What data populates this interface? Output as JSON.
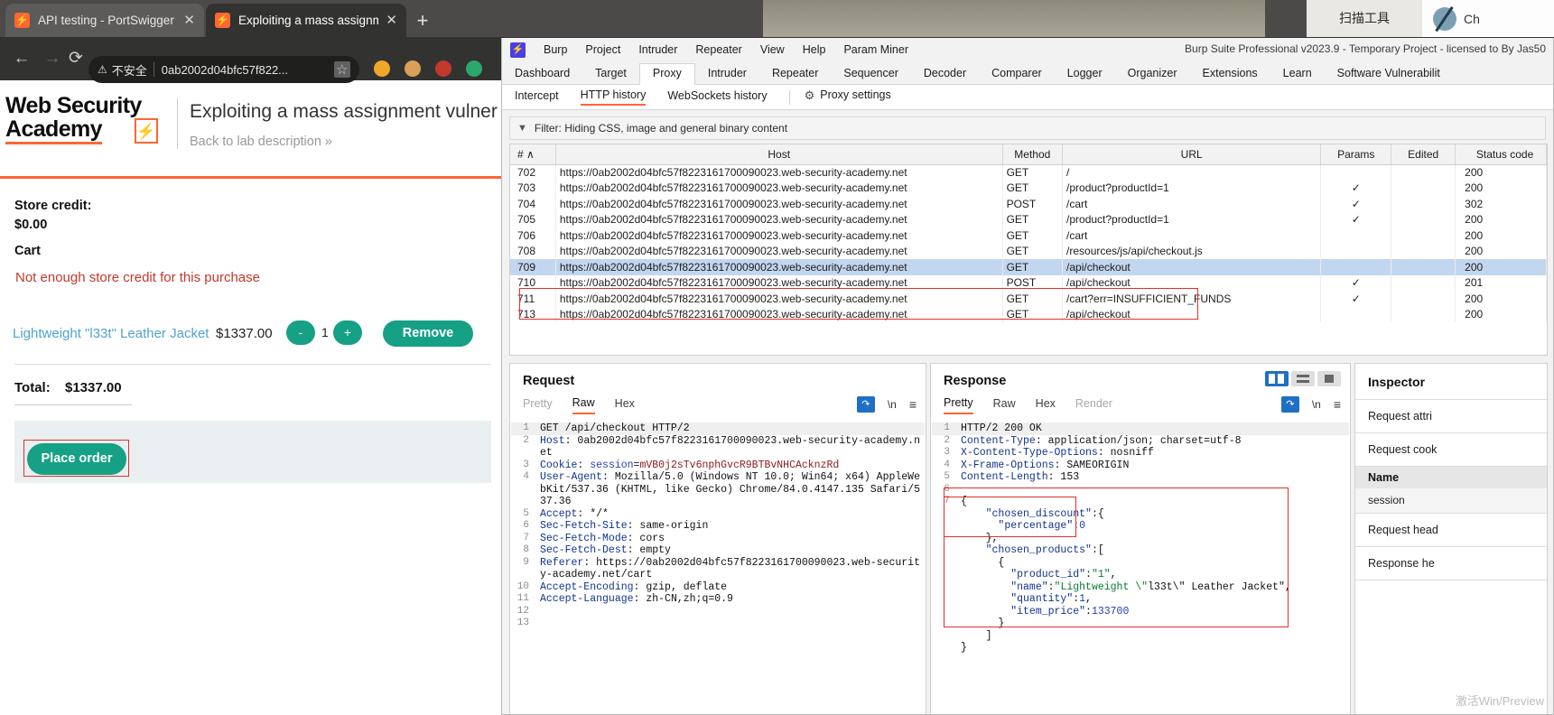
{
  "browser": {
    "tabs": [
      {
        "title": "API testing - PortSwigger",
        "active": false
      },
      {
        "title": "Exploiting a mass assignment v",
        "active": true
      }
    ],
    "new_tab_label": "+",
    "window_buttons": [
      "—",
      "❐",
      "✕"
    ],
    "nav": {
      "back": "←",
      "forward": "→",
      "reload": "⟳"
    },
    "omnibox": {
      "warning_icon": "⚠",
      "security_label": "不安全",
      "url": "0ab2002d04bfc57f822...",
      "translate_icon": "translate-icon",
      "star_icon": "☆"
    },
    "scan_tool_label": "扫描工具",
    "chrome_pill_label": "Ch"
  },
  "lab": {
    "logo_line1": "Web Security",
    "logo_line2": "Academy",
    "logo_bolt": "⚡",
    "title": "Exploiting a mass assignment vulner",
    "back_link": "Back to lab description  »",
    "store_credit_label": "Store credit:",
    "store_credit_value": "$0.00",
    "cart_label": "Cart",
    "cart_warning": "Not enough store credit for this purchase",
    "cart_item": {
      "name": "Lightweight \"l33t\" Leather Jacket",
      "price": "$1337.00",
      "minus": "-",
      "quantity": "1",
      "plus": "+",
      "remove": "Remove"
    },
    "total_label": "Total:",
    "total_value": "$1337.00",
    "place_order": "Place order"
  },
  "burp": {
    "window_title": "Burp Suite Professional v2023.9 - Temporary Project - licensed to By Jas50",
    "menu": [
      "Burp",
      "Project",
      "Intruder",
      "Repeater",
      "View",
      "Help",
      "Param Miner"
    ],
    "tabs": [
      {
        "label": "Dashboard",
        "active": false
      },
      {
        "label": "Target",
        "active": false
      },
      {
        "label": "Proxy",
        "active": true
      },
      {
        "label": "Intruder",
        "active": false
      },
      {
        "label": "Repeater",
        "active": false
      },
      {
        "label": "Sequencer",
        "active": false
      },
      {
        "label": "Decoder",
        "active": false
      },
      {
        "label": "Comparer",
        "active": false
      },
      {
        "label": "Logger",
        "active": false
      },
      {
        "label": "Organizer",
        "active": false
      },
      {
        "label": "Extensions",
        "active": false
      },
      {
        "label": "Learn",
        "active": false
      },
      {
        "label": "Software Vulnerabilit",
        "active": false
      }
    ],
    "subtabs": [
      {
        "label": "Intercept",
        "active": false
      },
      {
        "label": "HTTP history",
        "active": true
      },
      {
        "label": "WebSockets history",
        "active": false
      }
    ],
    "proxy_settings_label": "Proxy settings",
    "filter_text": "Filter: Hiding CSS, image and general binary content",
    "history": {
      "columns": [
        "#",
        "Host",
        "Method",
        "URL",
        "Params",
        "Edited",
        "Status code"
      ],
      "sort_indicator": "∧",
      "rows": [
        {
          "num": "702",
          "host": "https://0ab2002d04bfc57f8223161700090023.web-security-academy.net",
          "method": "GET",
          "url": "/",
          "params": "",
          "edited": "",
          "status": "200",
          "selected": false
        },
        {
          "num": "703",
          "host": "https://0ab2002d04bfc57f8223161700090023.web-security-academy.net",
          "method": "GET",
          "url": "/product?productId=1",
          "params": "✓",
          "edited": "",
          "status": "200",
          "selected": false
        },
        {
          "num": "704",
          "host": "https://0ab2002d04bfc57f8223161700090023.web-security-academy.net",
          "method": "POST",
          "url": "/cart",
          "params": "✓",
          "edited": "",
          "status": "302",
          "selected": false
        },
        {
          "num": "705",
          "host": "https://0ab2002d04bfc57f8223161700090023.web-security-academy.net",
          "method": "GET",
          "url": "/product?productId=1",
          "params": "✓",
          "edited": "",
          "status": "200",
          "selected": false
        },
        {
          "num": "706",
          "host": "https://0ab2002d04bfc57f8223161700090023.web-security-academy.net",
          "method": "GET",
          "url": "/cart",
          "params": "",
          "edited": "",
          "status": "200",
          "selected": false
        },
        {
          "num": "708",
          "host": "https://0ab2002d04bfc57f8223161700090023.web-security-academy.net",
          "method": "GET",
          "url": "/resources/js/api/checkout.js",
          "params": "",
          "edited": "",
          "status": "200",
          "selected": false
        },
        {
          "num": "709",
          "host": "https://0ab2002d04bfc57f8223161700090023.web-security-academy.net",
          "method": "GET",
          "url": "/api/checkout",
          "params": "",
          "edited": "",
          "status": "200",
          "selected": true
        },
        {
          "num": "710",
          "host": "https://0ab2002d04bfc57f8223161700090023.web-security-academy.net",
          "method": "POST",
          "url": "/api/checkout",
          "params": "✓",
          "edited": "",
          "status": "201",
          "selected": false
        },
        {
          "num": "711",
          "host": "https://0ab2002d04bfc57f8223161700090023.web-security-academy.net",
          "method": "GET",
          "url": "/cart?err=INSUFFICIENT_FUNDS",
          "params": "✓",
          "edited": "",
          "status": "200",
          "selected": false
        },
        {
          "num": "713",
          "host": "https://0ab2002d04bfc57f8223161700090023.web-security-academy.net",
          "method": "GET",
          "url": "/api/checkout",
          "params": "",
          "edited": "",
          "status": "200",
          "selected": false
        }
      ]
    },
    "request": {
      "title": "Request",
      "tabs": [
        {
          "label": "Pretty",
          "active": false,
          "disabled": false
        },
        {
          "label": "Raw",
          "active": true,
          "disabled": false
        },
        {
          "label": "Hex",
          "active": false,
          "disabled": false
        }
      ],
      "tools": {
        "wrap": "wrap-icon",
        "newline": "\\n",
        "menu": "≡"
      },
      "lines": [
        {
          "n": "1",
          "text": "GET /api/checkout HTTP/2"
        },
        {
          "n": "2",
          "text": "Host: 0ab2002d04bfc57f8223161700090023.web-security-academy.net"
        },
        {
          "n": "3",
          "text": "Cookie: session=mVB0j2sTv6nphGvcR9BTBvNHCAcknzRd"
        },
        {
          "n": "4",
          "text": "User-Agent: Mozilla/5.0 (Windows NT 10.0; Win64; x64) AppleWebKit/537.36 (KHTML, like Gecko) Chrome/84.0.4147.135 Safari/537.36"
        },
        {
          "n": "5",
          "text": "Accept: */*"
        },
        {
          "n": "6",
          "text": "Sec-Fetch-Site: same-origin"
        },
        {
          "n": "7",
          "text": "Sec-Fetch-Mode: cors"
        },
        {
          "n": "8",
          "text": "Sec-Fetch-Dest: empty"
        },
        {
          "n": "9",
          "text": "Referer: https://0ab2002d04bfc57f8223161700090023.web-security-academy.net/cart"
        },
        {
          "n": "10",
          "text": "Accept-Encoding: gzip, deflate"
        },
        {
          "n": "11",
          "text": "Accept-Language: zh-CN,zh;q=0.9"
        },
        {
          "n": "12",
          "text": ""
        },
        {
          "n": "13",
          "text": ""
        }
      ]
    },
    "response": {
      "title": "Response",
      "tabs": [
        {
          "label": "Pretty",
          "active": true,
          "disabled": false
        },
        {
          "label": "Raw",
          "active": false,
          "disabled": false
        },
        {
          "label": "Hex",
          "active": false,
          "disabled": false
        },
        {
          "label": "Render",
          "active": false,
          "disabled": true
        }
      ],
      "lines": [
        {
          "n": "1",
          "text": "HTTP/2 200 OK"
        },
        {
          "n": "2",
          "text": "Content-Type: application/json; charset=utf-8"
        },
        {
          "n": "3",
          "text": "X-Content-Type-Options: nosniff"
        },
        {
          "n": "4",
          "text": "X-Frame-Options: SAMEORIGIN"
        },
        {
          "n": "5",
          "text": "Content-Length: 153"
        },
        {
          "n": "6",
          "text": ""
        },
        {
          "n": "7",
          "text": "{"
        },
        {
          "n": "",
          "text": "    \"chosen_discount\":{"
        },
        {
          "n": "",
          "text": "      \"percentage\":0"
        },
        {
          "n": "",
          "text": "    },"
        },
        {
          "n": "",
          "text": "    \"chosen_products\":["
        },
        {
          "n": "",
          "text": "      {"
        },
        {
          "n": "",
          "text": "        \"product_id\":\"1\","
        },
        {
          "n": "",
          "text": "        \"name\":\"Lightweight \\\"l33t\\\" Leather Jacket\","
        },
        {
          "n": "",
          "text": "        \"quantity\":1,"
        },
        {
          "n": "",
          "text": "        \"item_price\":133700"
        },
        {
          "n": "",
          "text": "      }"
        },
        {
          "n": "",
          "text": "    ]"
        },
        {
          "n": "",
          "text": "}"
        }
      ]
    },
    "inspector": {
      "title": "Inspector",
      "sections": [
        "Request attri",
        "Request cook",
        "Request head",
        "Response he"
      ],
      "cookie_table": {
        "header": "Name",
        "rows": [
          "session"
        ]
      }
    },
    "layout_buttons": [
      "split-view",
      "stacked-view",
      "single-view"
    ]
  },
  "watermark": "激活Win/Preview"
}
